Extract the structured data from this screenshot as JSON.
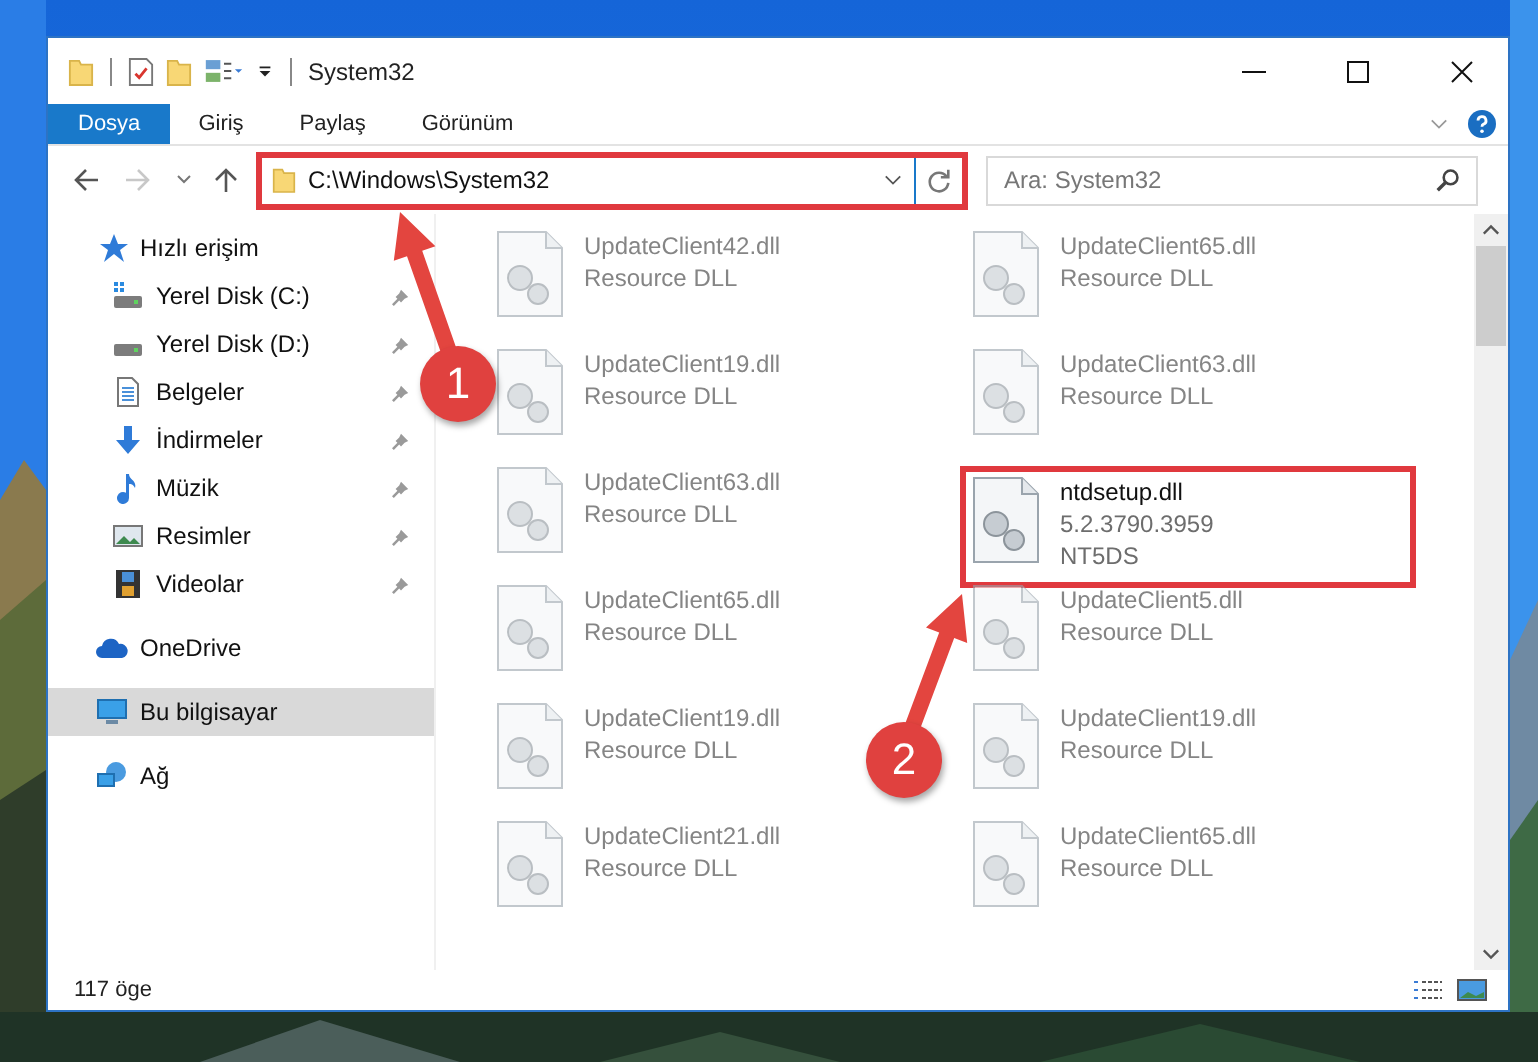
{
  "window": {
    "title": "System32"
  },
  "ribbon_tabs": [
    {
      "label": "Dosya",
      "selected": true
    },
    {
      "label": "Giriş",
      "selected": false
    },
    {
      "label": "Paylaş",
      "selected": false
    },
    {
      "label": "Görünüm",
      "selected": false
    }
  ],
  "address_bar": {
    "path": "C:\\Windows\\System32",
    "highlighted": true
  },
  "search": {
    "placeholder": "Ara: System32"
  },
  "navigation": [
    {
      "label": "Hızlı erişim",
      "kind": "star",
      "selected": false,
      "children": [
        {
          "label": "Yerel Disk (C:)",
          "kind": "system-drive",
          "pinned": true,
          "selected": false
        },
        {
          "label": "Yerel Disk (D:)",
          "kind": "drive",
          "pinned": true,
          "selected": false
        },
        {
          "label": "Belgeler",
          "kind": "documents",
          "pinned": true,
          "selected": false
        },
        {
          "label": "İndirmeler",
          "kind": "downloads",
          "pinned": true,
          "selected": false
        },
        {
          "label": "Müzik",
          "kind": "music",
          "pinned": true,
          "selected": false
        },
        {
          "label": "Resimler",
          "kind": "pictures",
          "pinned": true,
          "selected": false
        },
        {
          "label": "Videolar",
          "kind": "videos",
          "pinned": true,
          "selected": false
        }
      ]
    },
    {
      "label": "OneDrive",
      "kind": "cloud",
      "selected": false
    },
    {
      "label": "Bu bilgisayar",
      "kind": "computer",
      "selected": true
    },
    {
      "label": "Ağ",
      "kind": "network",
      "selected": false
    }
  ],
  "files": [
    {
      "name": "UpdateClient42.dll",
      "details": [
        "Resource DLL"
      ],
      "blurred": true,
      "highlighted": false
    },
    {
      "name": "UpdateClient65.dll",
      "details": [
        "Resource DLL"
      ],
      "blurred": true,
      "highlighted": false
    },
    {
      "name": "UpdateClient19.dll",
      "details": [
        "Resource DLL"
      ],
      "blurred": true,
      "highlighted": false
    },
    {
      "name": "UpdateClient63.dll",
      "details": [
        "Resource DLL"
      ],
      "blurred": true,
      "highlighted": false
    },
    {
      "name": "UpdateClient63.dll",
      "details": [
        "Resource DLL"
      ],
      "blurred": true,
      "highlighted": false
    },
    {
      "name": "ntdsetup.dll",
      "details": [
        "5.2.3790.3959",
        "NT5DS"
      ],
      "blurred": false,
      "highlighted": true
    },
    {
      "name": "UpdateClient65.dll",
      "details": [
        "Resource DLL"
      ],
      "blurred": true,
      "highlighted": false
    },
    {
      "name": "UpdateClient5.dll",
      "details": [
        "Resource DLL"
      ],
      "blurred": true,
      "highlighted": false
    },
    {
      "name": "UpdateClient19.dll",
      "details": [
        "Resource DLL"
      ],
      "blurred": true,
      "highlighted": false
    },
    {
      "name": "UpdateClient19.dll",
      "details": [
        "Resource DLL"
      ],
      "blurred": true,
      "highlighted": false
    },
    {
      "name": "UpdateClient21.dll",
      "details": [
        "Resource DLL"
      ],
      "blurred": true,
      "highlighted": false
    },
    {
      "name": "UpdateClient65.dll",
      "details": [
        "Resource DLL"
      ],
      "blurred": true,
      "highlighted": false
    }
  ],
  "status_bar": {
    "item_count": "117 öge"
  },
  "annotations": [
    {
      "label": "1"
    },
    {
      "label": "2"
    }
  ]
}
